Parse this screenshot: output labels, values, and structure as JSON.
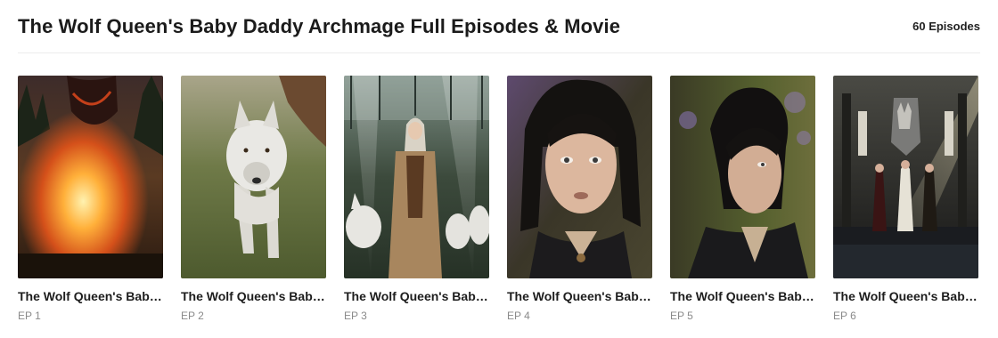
{
  "header": {
    "title": "The Wolf Queen's Baby Daddy Archmage Full Episodes & Movie",
    "episode_count": "60 Episodes"
  },
  "episodes": [
    {
      "title": "The Wolf Queen's Baby Daddy Archmage",
      "label": "EP 1",
      "thumbnail": "dragon-fire-scene"
    },
    {
      "title": "The Wolf Queen's Baby Daddy Archmage",
      "label": "EP 2",
      "thumbnail": "white-wolf-running"
    },
    {
      "title": "The Wolf Queen's Baby Daddy Archmage",
      "label": "EP 3",
      "thumbnail": "queen-with-wolves"
    },
    {
      "title": "The Wolf Queen's Baby Daddy Archmage",
      "label": "EP 4",
      "thumbnail": "dark-haired-man-portrait"
    },
    {
      "title": "The Wolf Queen's Baby Daddy Archmage",
      "label": "EP 5",
      "thumbnail": "dark-haired-man-profile"
    },
    {
      "title": "The Wolf Queen's Baby Daddy Archmage",
      "label": "EP 6",
      "thumbnail": "throne-hall-figures"
    }
  ]
}
